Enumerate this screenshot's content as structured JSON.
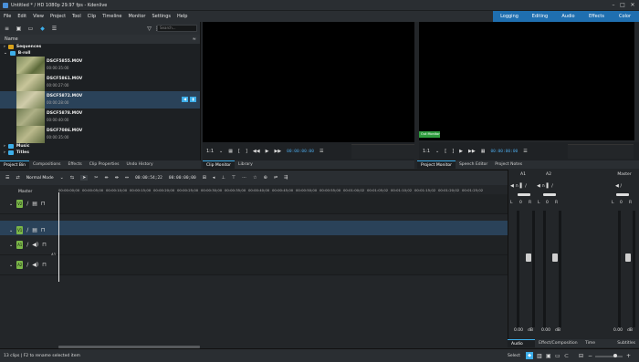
{
  "window": {
    "title": "Untitled * / HD 1080p 29.97 fps - Kdenlive"
  },
  "menu": [
    "File",
    "Edit",
    "View",
    "Project",
    "Tool",
    "Clip",
    "Timeline",
    "Monitor",
    "Settings",
    "Help"
  ],
  "layouts": [
    "Logging",
    "Editing",
    "Audio",
    "Effects",
    "Color"
  ],
  "bin": {
    "search_placeholder": "Search...",
    "header": "Name",
    "folders": [
      {
        "name": "Sequences",
        "color": "#d9a21b"
      },
      {
        "name": "B-roll",
        "color": "#3daee9"
      }
    ],
    "clips": [
      {
        "name": "DSCF5855.MOV",
        "duration": "00:00:35:00"
      },
      {
        "name": "DSCF5861.MOV",
        "duration": "00:00:27:00"
      },
      {
        "name": "DSCF5872.MOV",
        "duration": "00:00:28:00"
      },
      {
        "name": "DSCF5878.MOV",
        "duration": "00:00:40:00"
      },
      {
        "name": "DSCF7086.MOV",
        "duration": "00:00:35:00"
      }
    ],
    "bottom_folders": [
      {
        "name": "Music",
        "color": "#3daee9"
      },
      {
        "name": "Titles",
        "color": "#3daee9"
      }
    ],
    "tabs": [
      "Project Bin",
      "Compositions",
      "Effects",
      "Clip Properties",
      "Undo History"
    ]
  },
  "clip_monitor": {
    "zoom": "1:1",
    "timecode": "00:00:00:00",
    "tabs": [
      "Clip Monitor",
      "Library"
    ]
  },
  "project_monitor": {
    "zoom": "1:1",
    "timecode": "00:00:00:00",
    "badge": "Out Monitor",
    "tabs": [
      "Project Monitor",
      "Speech Editor",
      "Project Notes"
    ]
  },
  "timeline": {
    "mode": "Normal Mode",
    "position": "00:00:54;22",
    "duration": "00:00:00;00",
    "master_label": "Master",
    "ruler": [
      "00:00:00;00",
      "00:00:05;00",
      "00:00:10;00",
      "00:00:15;00",
      "00:00:20;00",
      "00:00:25;00",
      "00:00:30;00",
      "00:00:35;00",
      "00:00:40;00",
      "00:00:45;00",
      "00:00:50;00",
      "00:00:55;00",
      "00:01:00;02",
      "00:01:05;02",
      "00:01:10;02",
      "00:01:15;02",
      "00:01:20;02",
      "00:01:25;02",
      "00:01:30;02",
      "00:01:35;02"
    ],
    "tracks": [
      {
        "badge": "V2",
        "kind": "video",
        "selected": false
      },
      {
        "badge": "V1",
        "kind": "video",
        "selected": true
      },
      {
        "badge": "A1",
        "kind": "audio",
        "selected": false
      },
      {
        "badge": "A2",
        "kind": "audio",
        "selected": false
      }
    ],
    "a1_label": "A1"
  },
  "mixer": {
    "strips": [
      {
        "label": "A1",
        "L": "L",
        "gain": "0",
        "R": "R",
        "db": "0.00",
        "unit": "dB"
      },
      {
        "label": "A2",
        "L": "L",
        "gain": "0",
        "R": "R",
        "db": "0.00",
        "unit": "dB"
      },
      {
        "label": "Master",
        "L": "L",
        "gain": "0",
        "R": "R",
        "db": "0.00",
        "unit": "dB"
      }
    ],
    "tabs": [
      "Audio Mix...",
      "Effect/Composition S...",
      "Time Remap...",
      "Subtitles"
    ]
  },
  "status": {
    "text": "13 clips | F2 to rename selected item",
    "select_label": "Select"
  },
  "colors": {
    "accent": "#3daee9",
    "layout_bar": "#1f6fb0",
    "selection": "#2a4259",
    "track_badge": "#7ab648"
  }
}
